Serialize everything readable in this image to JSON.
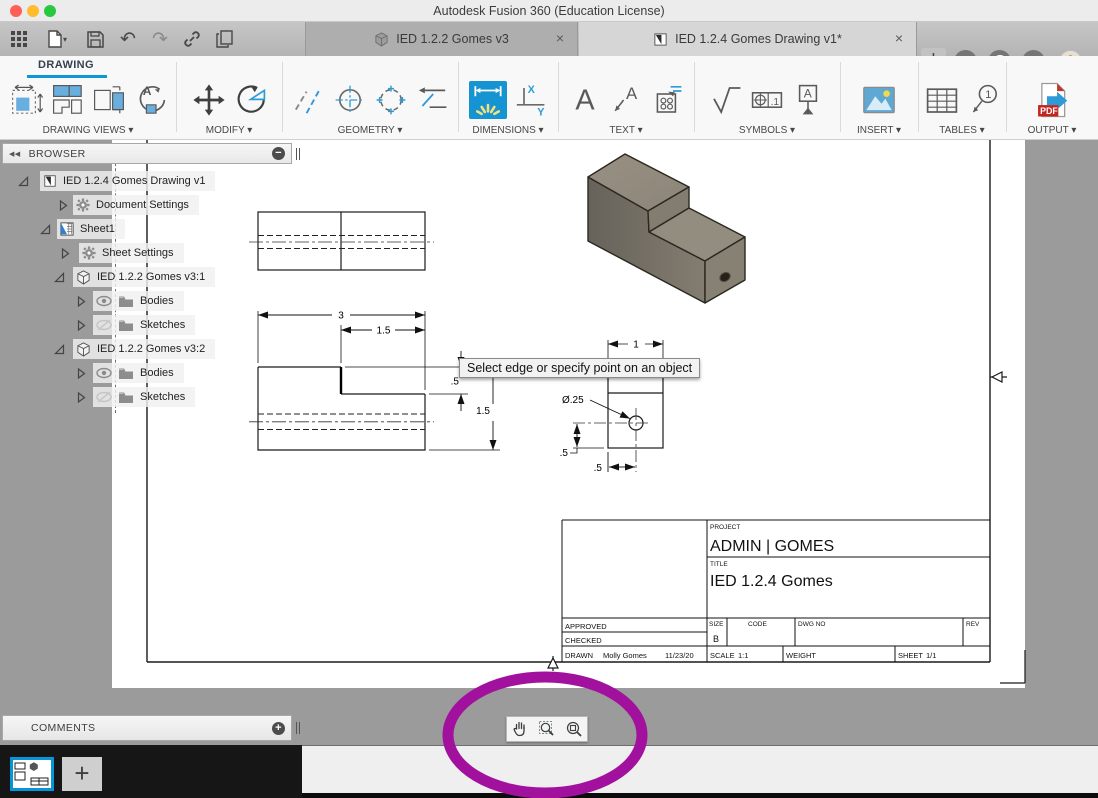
{
  "window": {
    "title": "Autodesk Fusion 360 (Education License)"
  },
  "tabbar": {
    "inactive_tab": {
      "label": "IED 1.2.2 Gomes v3",
      "close": "×"
    },
    "active_tab": {
      "label": "IED 1.2.4 Gomes Drawing v1*",
      "close": "×"
    },
    "add": "+",
    "help": "?"
  },
  "ribbon": {
    "tab": "DRAWING",
    "caret": "▾",
    "groups": [
      {
        "label": "DRAWING VIEWS"
      },
      {
        "label": "MODIFY"
      },
      {
        "label": "GEOMETRY"
      },
      {
        "label": "DIMENSIONS"
      },
      {
        "label": "TEXT"
      },
      {
        "label": "SYMBOLS"
      },
      {
        "label": "INSERT"
      },
      {
        "label": "TABLES"
      },
      {
        "label": "OUTPUT"
      }
    ]
  },
  "browser": {
    "title": "BROWSER",
    "collapse_glyph": "◀◀",
    "minus": "−",
    "items": [
      {
        "label": "IED 1.2.4 Gomes Drawing v1"
      },
      {
        "label": "Document Settings"
      },
      {
        "label": "Sheet1"
      },
      {
        "label": "Sheet Settings"
      },
      {
        "label": "IED 1.2.2 Gomes v3:1"
      },
      {
        "label": "Bodies"
      },
      {
        "label": "Sketches"
      },
      {
        "label": "IED 1.2.2 Gomes v3:2"
      },
      {
        "label": "Bodies"
      },
      {
        "label": "Sketches"
      }
    ]
  },
  "comments": {
    "title": "COMMENTS",
    "plus": "+"
  },
  "tooltip": {
    "text": "Select edge or specify point on an object"
  },
  "drawing": {
    "dims": {
      "overall_width": "3",
      "step_width": "1.5",
      "step_depth": ".5",
      "overall_height": "1.5",
      "side_width": "1",
      "hole_dia": "Ø.25",
      "hole_v": ".5",
      "hole_h": ".5"
    },
    "title_block": {
      "project_label": "PROJECT",
      "project": "ADMIN | GOMES",
      "title_label": "TITLE",
      "title": "IED 1.2.4 Gomes",
      "approved_label": "APPROVED",
      "checked_label": "CHECKED",
      "drawn_label": "DRAWN",
      "drawn_by": "Molly Gomes",
      "drawn_date": "11/23/20",
      "size_label": "SIZE",
      "size": "B",
      "code_label": "CODE",
      "dwg_label": "DWG NO",
      "rev_label": "REV",
      "scale_label": "SCALE",
      "scale": "1:1",
      "weight_label": "WEIGHT",
      "sheet_label": "SHEET",
      "sheet": "1/1"
    }
  },
  "colors": {
    "accent": "#0696d7",
    "annotation": "#a2119e"
  }
}
